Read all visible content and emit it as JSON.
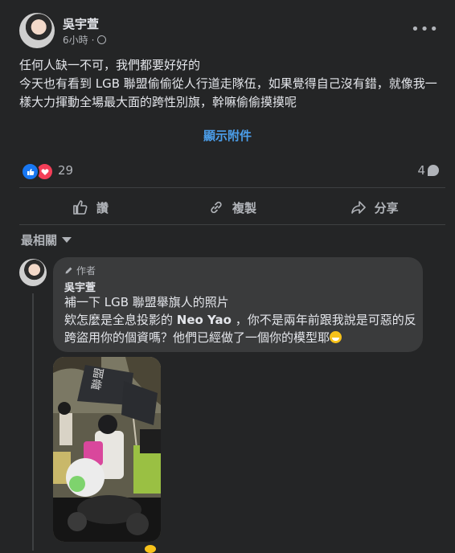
{
  "post": {
    "author": "吳宇萱",
    "time": "6小時",
    "separator": "·",
    "lines": [
      "任何人缺一不可，我們都要好好的",
      "今天也有看到 LGB 聯盟偷偷從人行道走隊伍，如果覺得自己沒有錯，就像我一樣大力揮動全場最大面的跨性別旗，幹嘛偷偷摸摸呢"
    ],
    "show_attachment": "顯示附件"
  },
  "stats": {
    "reactions": "29",
    "comments": "4"
  },
  "actions": {
    "like": "讚",
    "copy": "複製",
    "share": "分享"
  },
  "sort": {
    "label": "最相關"
  },
  "comment": {
    "badge": "作者",
    "author": "吳宇萱",
    "line1": "補一下 LGB 聯盟舉旗人的照片",
    "line2_pre": "欸怎麼是全息投影的 ",
    "mention": "Neo Yao",
    "line2_post": " ，你不是兩年前跟我說是可惡的反跨盜用你的個資嗎？他們已經做了一個你的模型耶"
  },
  "photo": {
    "flag_text": "聯盟"
  },
  "icons": {
    "more": "more-dots-icon",
    "globe": "globe-icon",
    "like": "thumbs-up-icon",
    "copy": "link-icon",
    "share": "share-arrow-icon",
    "comment": "comment-bubble-icon",
    "pencil": "pencil-icon"
  },
  "colors": {
    "background": "#242526",
    "link": "#4b9eea",
    "like": "#1877f2",
    "love": "#f33e58",
    "bubble": "#3a3b3c"
  }
}
